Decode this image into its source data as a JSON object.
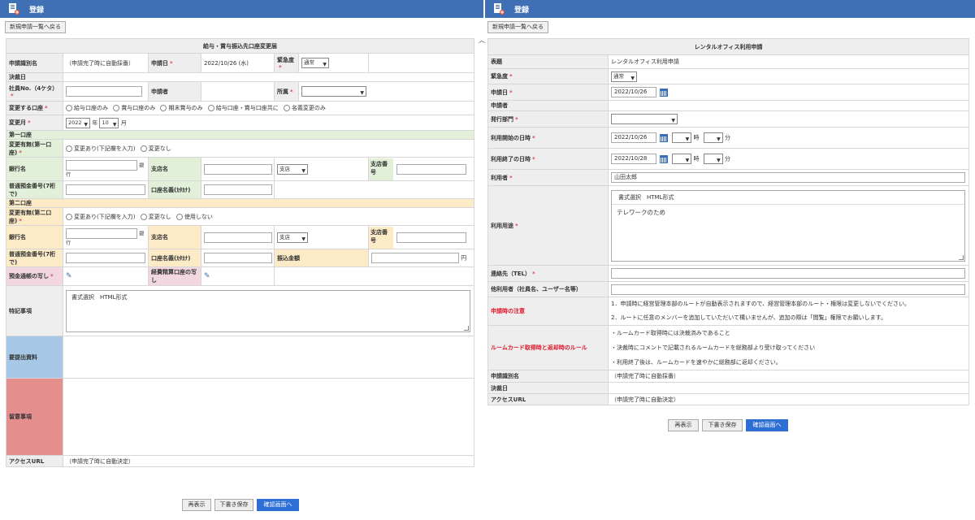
{
  "left": {
    "topbar_title": "登録",
    "back_button": "新規申請一覧へ戻る",
    "form_title": "給与・賞与振込先口座変更届",
    "labels": {
      "doc_id": "申請識別名",
      "apply_date": "申請日",
      "urgency": "緊急度",
      "decision_date": "決裁日",
      "emp_no": "社員No.（4ケタ）",
      "applicant": "申請者",
      "dept": "所属",
      "target_account": "変更する口座",
      "change_month": "変更月",
      "year_unit": "年",
      "month_unit": "月",
      "first_account": "第一口座",
      "change_flag1": "変更有無(第一口座)",
      "bank_name": "銀行名",
      "bank_suffix": "銀行",
      "branch_name": "支店名",
      "branch_no": "支店番号",
      "account_no": "普通預金番号(7桁で)",
      "account_holder": "口座名義(ｶﾀｶﾅ)",
      "second_account": "第二口座",
      "change_flag2": "変更有無(第二口座)",
      "transfer_amount": "振込金額",
      "yen": "円",
      "passbook_copy": "預金通帳の写し",
      "expense_copy": "経費精算口座の写し",
      "notes": "特記事項",
      "required_docs": "要提出資料",
      "caution": "留意事項",
      "access_url": "アクセスURL"
    },
    "values": {
      "doc_id": "（申請完了時に自動採番）",
      "apply_date": "2022/10/26 (水)",
      "urgency": "通常",
      "year": "2022",
      "month": "10",
      "branch_type": "支店",
      "access_url": "（申請完了時に自動決定）",
      "notes_text": "書式選択　HTML形式"
    },
    "target_options": [
      "給与口座のみ",
      "賞与口座のみ",
      "期末賞与のみ",
      "給与口座・賞与口座共に",
      "名義変更のみ"
    ],
    "change_options1": [
      "変更あり(下記欄を入力)",
      "変更なし"
    ],
    "change_options2": [
      "変更あり(下記欄を入力)",
      "変更なし",
      "使用しない"
    ],
    "buttons": {
      "redisplay": "再表示",
      "draft": "下書き保存",
      "confirm": "確認画面へ"
    }
  },
  "right": {
    "topbar_title": "登録",
    "back_button": "新規申請一覧へ戻る",
    "form_title": "レンタルオフィス利用申請",
    "labels": {
      "subject": "表題",
      "urgency": "緊急度",
      "apply_date": "申請日",
      "applicant": "申請者",
      "issuing_dept": "発行部門",
      "start_datetime": "利用開始の日時",
      "end_datetime": "利用終了の日時",
      "user": "利用者",
      "purpose": "利用用途",
      "contact": "連絡先（TEL）",
      "other_users": "他利用者（社員名、ユーザー名等）",
      "notice": "申請時の注意",
      "card_rule": "ルームカード取得時と返却時のルール",
      "doc_id": "申請識別名",
      "decision_date": "決裁日",
      "access_url": "アクセスURL",
      "hour_unit": "時",
      "min_unit": "分"
    },
    "values": {
      "subject": "レンタルオフィス利用申請",
      "urgency": "通常",
      "apply_date": "2022/10/26",
      "start_date": "2022/10/26",
      "end_date": "2022/10/28",
      "user": "山田太郎",
      "format": "書式選択　HTML形式",
      "purpose_text": "テレワークのため",
      "notice1": "1．申請時に経営管理本部のルートが自動表示されますので、経営管理本部のルート・権限は変更しないでください。",
      "notice2": "2．ルートに任意のメンバーを追加していただいて構いませんが、追加の際は「閲覧」権限でお願いします。",
      "rule1": "・ルームカード取得時には決裁済みであること",
      "rule2": "・決裁時にコメントで記載されるルームカードを総務部より受け取ってください",
      "rule3": "・利用終了後は、ルームカードを速やかに総務部に返却ください。",
      "doc_id": "（申請完了時に自動採番）",
      "access_url": "（申請完了時に自動決定）"
    },
    "buttons": {
      "redisplay": "再表示",
      "draft": "下書き保存",
      "confirm": "確認画面へ"
    }
  },
  "colors": {
    "topbar": "#3f6fb5",
    "primary_button": "#2e6fd6",
    "required": "#e0454e"
  },
  "icons": [
    "document-add-icon",
    "paperclip-icon",
    "calendar-icon"
  ]
}
